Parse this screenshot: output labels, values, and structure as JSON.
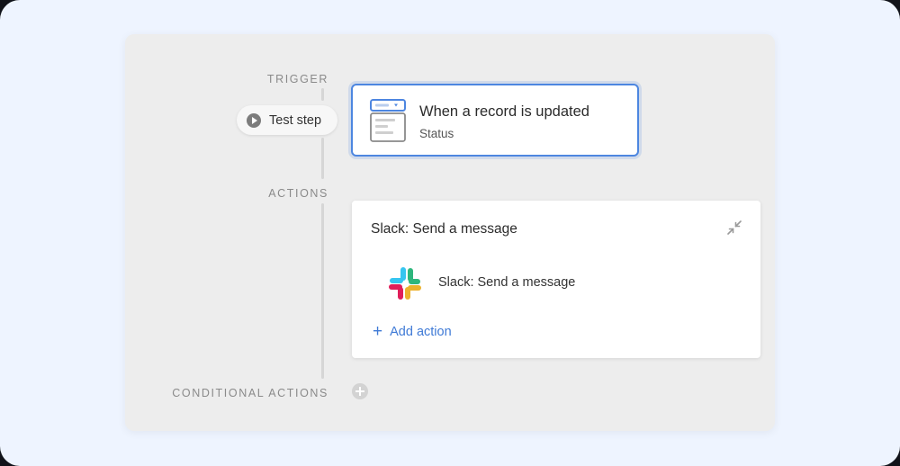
{
  "workflow": {
    "sections": {
      "trigger_label": "TRIGGER",
      "actions_label": "ACTIONS",
      "conditional_label": "CONDITIONAL ACTIONS"
    },
    "test_step": {
      "label": "Test step",
      "icon": "play-icon"
    },
    "trigger": {
      "title": "When a record is updated",
      "subtitle": "Status",
      "icon": "record-form-icon",
      "accent_color": "#4d86e0"
    },
    "action_group": {
      "title": "Slack: Send a message",
      "collapse_icon": "collapse-arrows-icon",
      "items": [
        {
          "label": "Slack: Send a message",
          "icon": "slack-logo"
        }
      ],
      "add_action_label": "Add action",
      "add_icon": "plus-icon",
      "link_color": "#3f7ad6"
    },
    "conditional": {
      "add_icon": "plus-circle-icon"
    }
  }
}
